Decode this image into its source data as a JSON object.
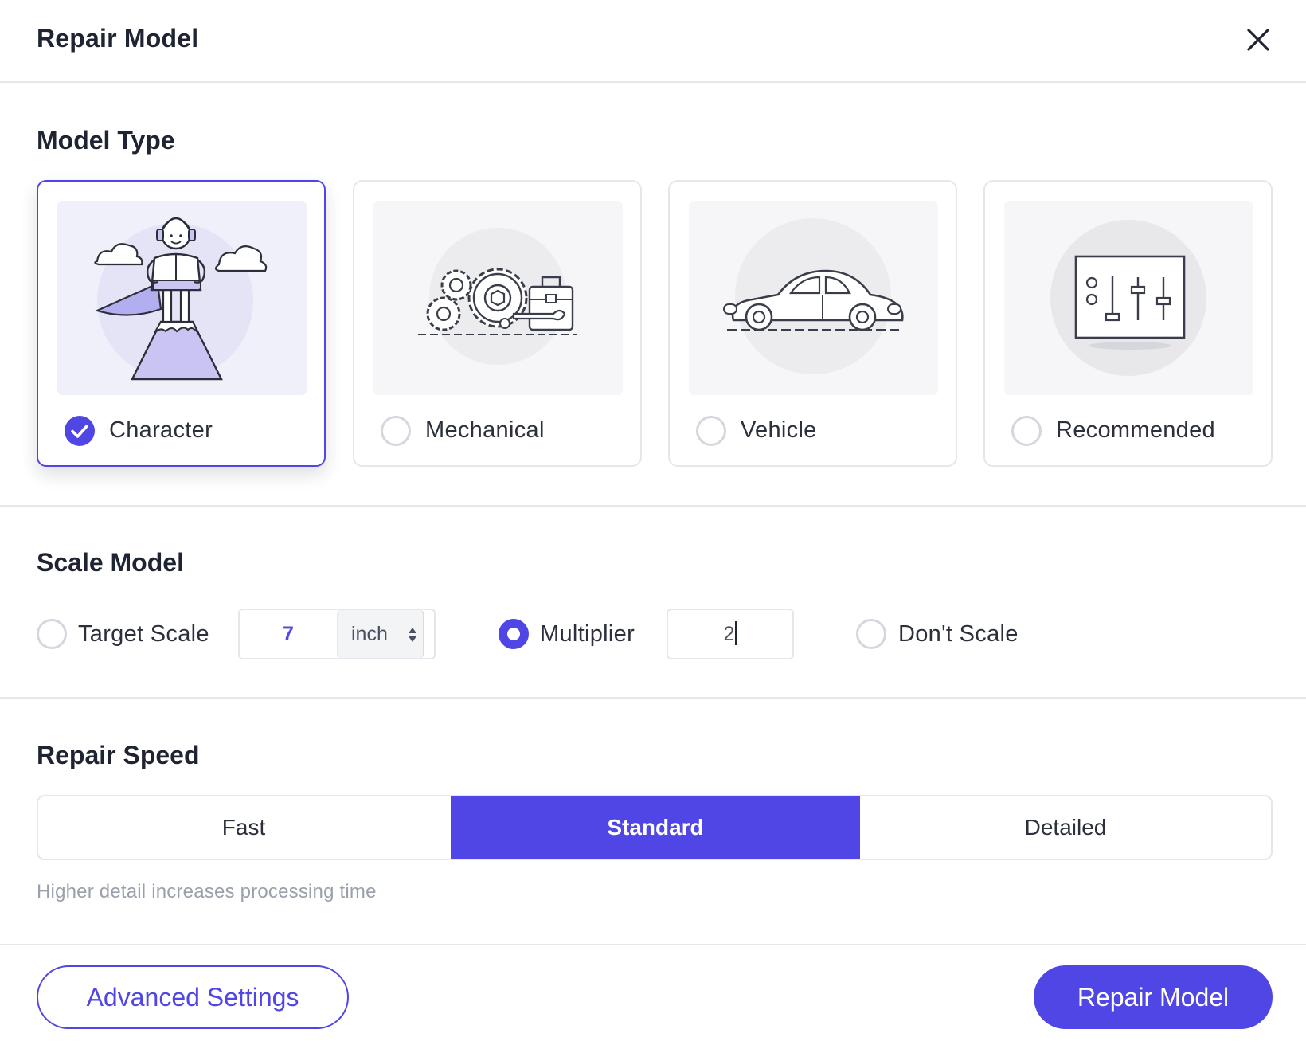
{
  "dialog": {
    "title": "Repair Model",
    "close_icon": "close-icon"
  },
  "model_type": {
    "title": "Model Type",
    "options": [
      {
        "label": "Character",
        "icon": "character-illustration",
        "selected": true
      },
      {
        "label": "Mechanical",
        "icon": "gears-toolbox-illustration",
        "selected": false
      },
      {
        "label": "Vehicle",
        "icon": "car-illustration",
        "selected": false
      },
      {
        "label": "Recommended",
        "icon": "sliders-illustration",
        "selected": false
      }
    ]
  },
  "scale_model": {
    "title": "Scale Model",
    "target_scale": {
      "label": "Target Scale",
      "value": "7",
      "unit": "inch",
      "selected": false
    },
    "multiplier": {
      "label": "Multiplier",
      "value": "2",
      "selected": true
    },
    "dont_scale": {
      "label": "Don't Scale",
      "selected": false
    }
  },
  "repair_speed": {
    "title": "Repair Speed",
    "options": [
      "Fast",
      "Standard",
      "Detailed"
    ],
    "selected": "Standard",
    "hint": "Higher detail increases processing time"
  },
  "footer": {
    "advanced_label": "Advanced Settings",
    "repair_label": "Repair Model"
  },
  "colors": {
    "accent": "#4f46e5",
    "border": "#e4e7ec",
    "text": "#1f2433",
    "hint": "#9aa0ab"
  }
}
